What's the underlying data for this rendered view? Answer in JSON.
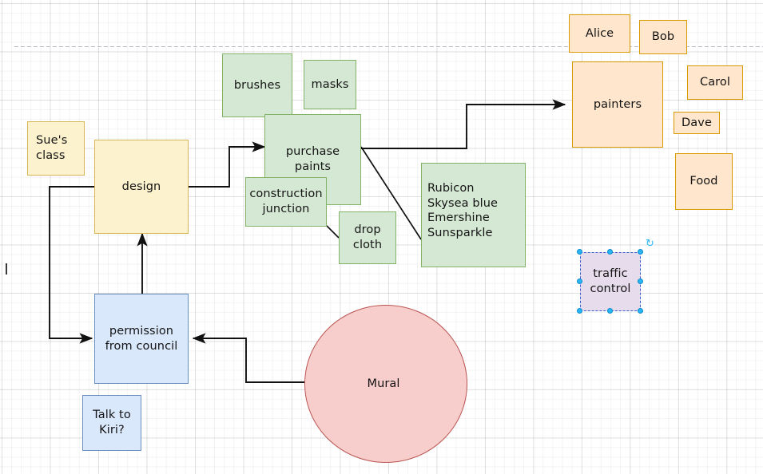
{
  "app": {
    "kind": "diagram-canvas",
    "grid_visible": true,
    "guideline_visible": true
  },
  "palette": {
    "yellow_fill": "#fcf2cd",
    "yellow_stroke": "#d6b656",
    "green_fill": "#d5e8d4",
    "green_stroke": "#82b366",
    "blue_fill": "#dae8fc",
    "blue_stroke": "#6c8ebf",
    "orange_fill": "#ffe6cc",
    "orange_stroke": "#d79b00",
    "pink_fill": "#f8cecc",
    "pink_stroke": "#b85450",
    "purple_fill": "#e1d5e7",
    "purple_stroke": "#9673a6",
    "selection_handle": "#29b6f6",
    "selection_outline": "#3a5fcd",
    "edge_color": "#111111",
    "guideline_color": "#b9b9c9"
  },
  "nodes": {
    "sues_class": {
      "label": "Sue's\nclass"
    },
    "design": {
      "label": "design"
    },
    "brushes": {
      "label": "brushes"
    },
    "masks": {
      "label": "masks"
    },
    "purchase_paints": {
      "label": "purchase\npaints"
    },
    "construction_junction": {
      "label": "construction\njunction"
    },
    "drop_cloth": {
      "label": "drop\ncloth"
    },
    "paint_colors": {
      "label": "Rubicon\nSkysea blue\nEmershine\nSunsparkle"
    },
    "permission": {
      "label": "permission\nfrom council"
    },
    "talk_to_kiri": {
      "label": "Talk to\nKiri?"
    },
    "mural": {
      "label": "Mural"
    },
    "alice": {
      "label": "Alice"
    },
    "bob": {
      "label": "Bob"
    },
    "painters": {
      "label": "painters"
    },
    "carol": {
      "label": "Carol"
    },
    "dave": {
      "label": "Dave"
    },
    "food": {
      "label": "Food"
    },
    "traffic_control": {
      "label": "traffic\ncontrol",
      "selected": true
    }
  },
  "selection": {
    "rotate_icon": "rotate-icon",
    "rotate_glyph": "↻",
    "handle_count": 8
  },
  "paint_colors_list": [
    "Rubicon",
    "Skysea blue",
    "Emershine",
    "Sunsparkle"
  ],
  "people_list": [
    "Alice",
    "Bob",
    "Carol",
    "Dave"
  ],
  "edges": [
    {
      "from": "design",
      "to": "purchase_paints",
      "arrow": true
    },
    {
      "from": "purchase_paints",
      "to": "painters",
      "arrow": true
    },
    {
      "from": "purchase_paints",
      "to": "paint_colors",
      "arrow": false
    },
    {
      "from": "construction_junction",
      "to": "drop_cloth",
      "arrow": false
    },
    {
      "from": "permission",
      "to": "design",
      "arrow": true
    },
    {
      "from": "design",
      "to": "permission",
      "arrow": true
    },
    {
      "from": "mural",
      "to": "permission",
      "arrow": true
    }
  ]
}
